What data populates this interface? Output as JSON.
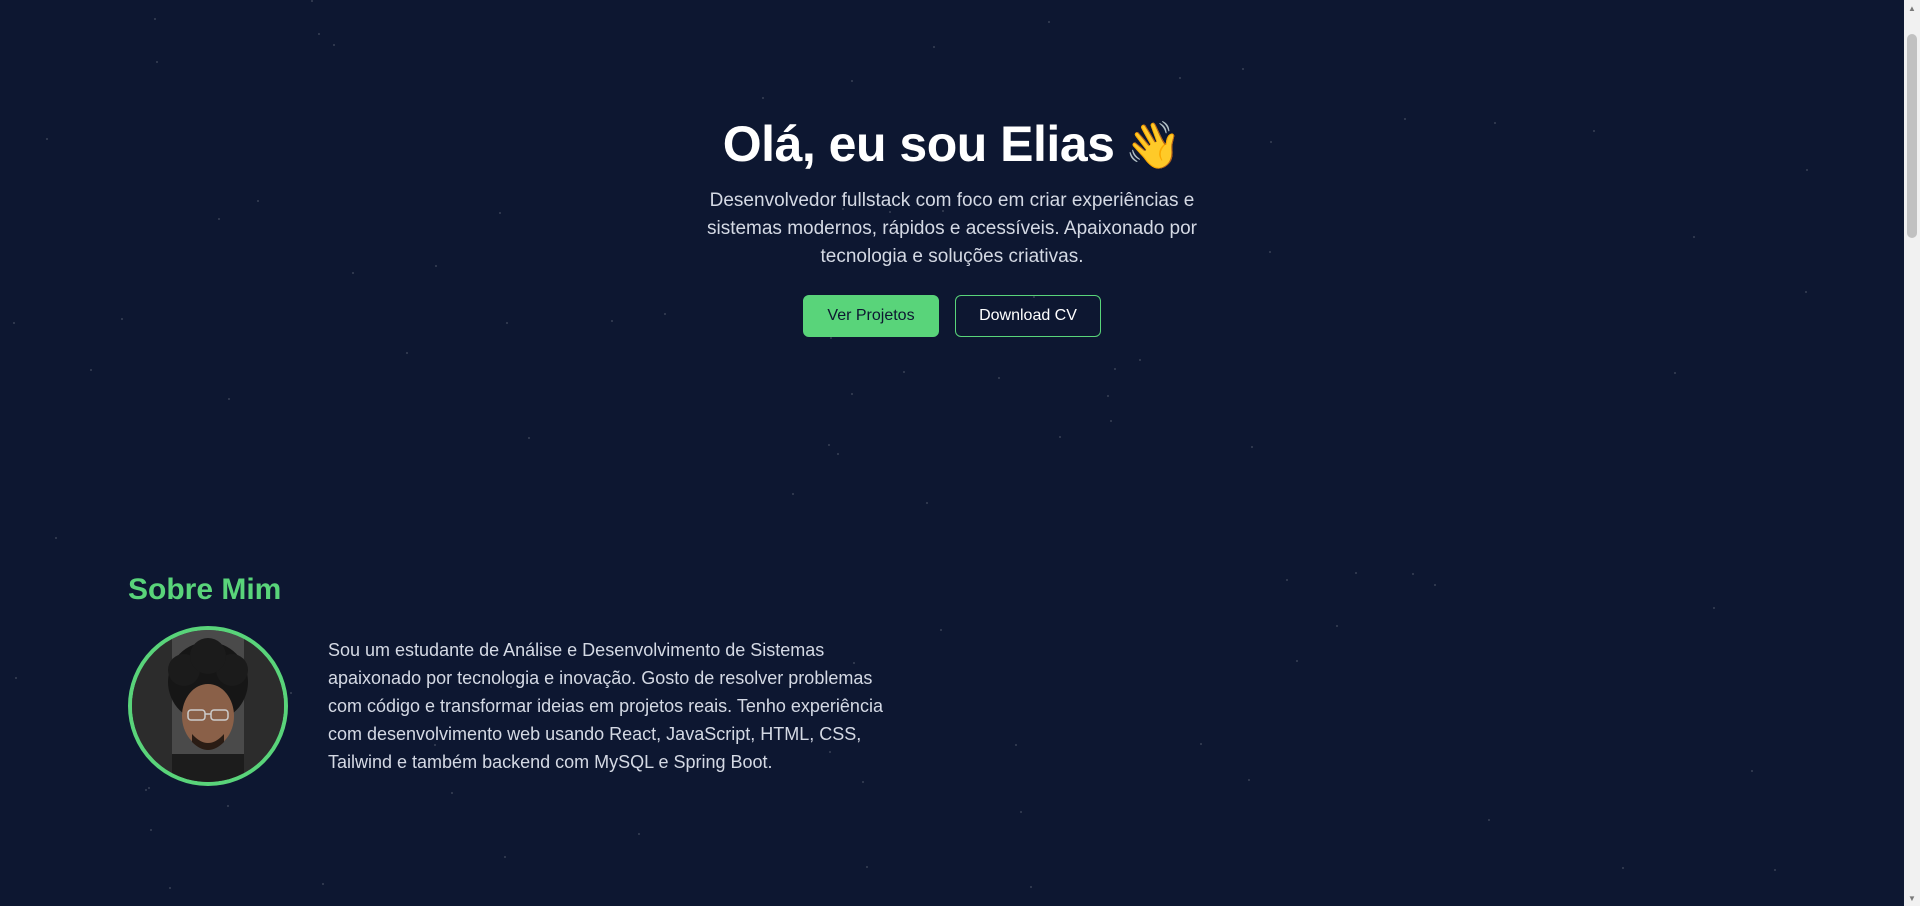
{
  "colors": {
    "background": "#0d1731",
    "accent": "#59d47a",
    "text_primary": "#ffffff",
    "text_secondary": "#d4d9e4"
  },
  "hero": {
    "title": "Olá, eu sou Elias",
    "wave_emoji": "👋",
    "description": "Desenvolvedor fullstack com foco em criar experiências e sistemas modernos, rápidos e acessíveis. Apaixonado por tecnologia e soluções criativas.",
    "primary_button": "Ver Projetos",
    "secondary_button": "Download CV"
  },
  "about": {
    "title": "Sobre Mim",
    "avatar_icon": "profile-photo",
    "text": "Sou um estudante de Análise e Desenvolvimento de Sistemas apaixonado por tecnologia e inovação. Gosto de resolver problemas com código e transformar ideias em projetos reais. Tenho experiência com desenvolvimento web usando React, JavaScript, HTML, CSS, Tailwind e também backend com MySQL e Spring Boot."
  },
  "scrollbar": {
    "up_icon": "▲",
    "down_icon": "▼"
  }
}
